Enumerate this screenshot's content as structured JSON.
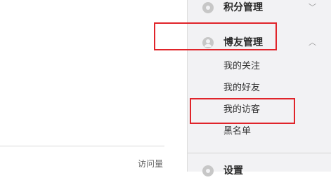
{
  "main": {
    "visits_label": "访问量"
  },
  "sidebar": {
    "sections": [
      {
        "title": "积分管理",
        "icon": "target-icon",
        "expanded": false,
        "chevron": "﹀"
      },
      {
        "title": "博友管理",
        "icon": "user-icon",
        "expanded": true,
        "chevron": "︿",
        "items": [
          "我的关注",
          "我的好友",
          "我的访客",
          "黑名单"
        ]
      },
      {
        "title": "设置",
        "icon": "settings-icon"
      }
    ]
  },
  "highlight_color": "#e0242a"
}
